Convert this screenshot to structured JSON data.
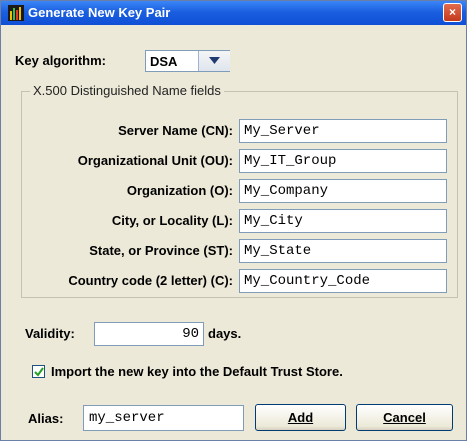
{
  "window": {
    "title": "Generate New Key Pair",
    "close_label": "×"
  },
  "algorithm": {
    "label": "Key algorithm:",
    "value": "DSA"
  },
  "dn_group": {
    "title": "X.500 Distinguished Name fields",
    "fields": [
      {
        "label": "Server Name (CN):",
        "value": "My_Server"
      },
      {
        "label": "Organizational Unit (OU):",
        "value": "My_IT_Group"
      },
      {
        "label": "Organization (O):",
        "value": "My_Company"
      },
      {
        "label": "City, or Locality (L):",
        "value": "My_City"
      },
      {
        "label": "State, or Province (ST):",
        "value": "My_State"
      },
      {
        "label": "Country code (2 letter) (C):",
        "value": "My_Country_Code"
      }
    ]
  },
  "validity": {
    "label": "Validity:",
    "value": "90",
    "unit": "days."
  },
  "import_option": {
    "label": "Import the new key into the Default Trust Store.",
    "checked": true
  },
  "alias": {
    "label": "Alias:",
    "value": "my_server"
  },
  "buttons": {
    "add": "Add",
    "cancel": "Cancel"
  }
}
